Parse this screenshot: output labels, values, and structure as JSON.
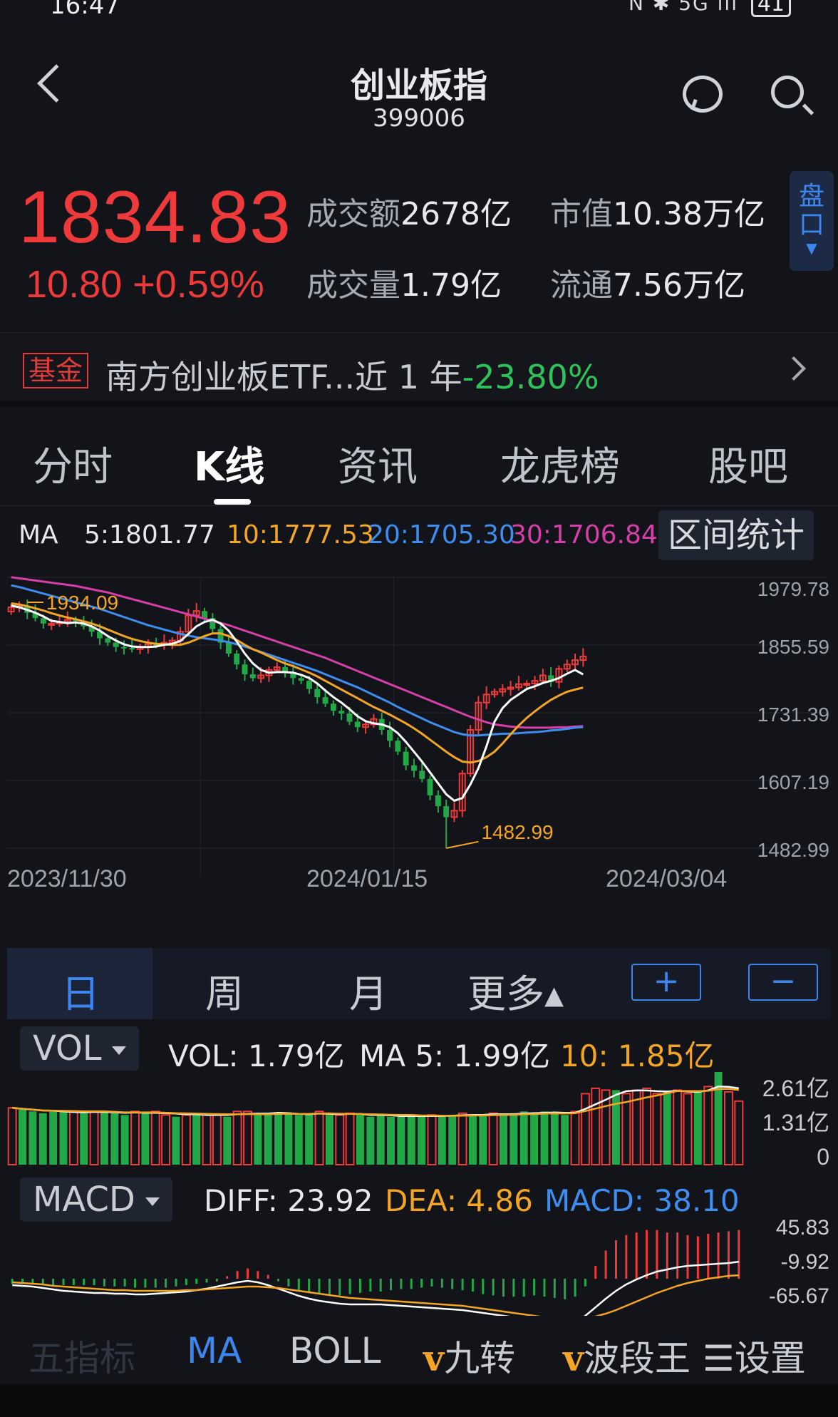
{
  "status_bar": {
    "time": "16:47",
    "battery": "41",
    "signal": "N ✱ 5G ıll"
  },
  "header": {
    "title": "创业板指",
    "code": "399006"
  },
  "quote": {
    "price": "1834.83",
    "change": "10.80 +0.59%",
    "turnover_label": "成交额",
    "turnover_value": "2678亿",
    "market_cap_label": "市值",
    "market_cap_value": "10.38万亿",
    "volume_label": "成交量",
    "volume_value": "1.79亿",
    "float_label": "流通",
    "float_value": "7.56万亿",
    "pankou_label": "盘口",
    "up_color": "#ee3a3a",
    "down_color": "#22a846"
  },
  "fund": {
    "tag": "基金",
    "name": "南方创业板ETF...近 1 年",
    "return": "-23.80%"
  },
  "tabs": [
    {
      "label": "分时"
    },
    {
      "label": "K线",
      "active": true
    },
    {
      "label": "资讯"
    },
    {
      "label": "龙虎榜"
    },
    {
      "label": "股吧"
    }
  ],
  "ma_legend": {
    "label": "MA",
    "ma5": "5:1801.77",
    "ma10": "10:1777.53",
    "ma20": "20:1705.30",
    "ma30": "30:1706.84",
    "range_button": "区间统计",
    "colors": {
      "ma5": "#ffffff",
      "ma10": "#f5a524",
      "ma20": "#3d8ef0",
      "ma30": "#d63fa7"
    }
  },
  "chart_data": {
    "type": "candlestick",
    "y_ticks": [
      "1979.78",
      "1855.59",
      "1731.39",
      "1607.19",
      "1482.99"
    ],
    "ylim": [
      1482.99,
      1979.78
    ],
    "x_ticks": [
      "2023/11/30",
      "2024/01/15",
      "2024/03/04"
    ],
    "annotations": [
      {
        "text": "1934.09"
      },
      {
        "text": "1482.99"
      }
    ],
    "close": [
      1925,
      1927,
      1915,
      1905,
      1895,
      1895,
      1898,
      1902,
      1900,
      1890,
      1880,
      1868,
      1860,
      1852,
      1850,
      1848,
      1852,
      1857,
      1856,
      1860,
      1864,
      1880,
      1910,
      1918,
      1905,
      1885,
      1860,
      1840,
      1820,
      1802,
      1795,
      1800,
      1810,
      1815,
      1805,
      1795,
      1790,
      1775,
      1760,
      1748,
      1735,
      1730,
      1715,
      1705,
      1710,
      1720,
      1700,
      1680,
      1660,
      1635,
      1625,
      1610,
      1580,
      1560,
      1540,
      1552,
      1620,
      1700,
      1750,
      1765,
      1770,
      1775,
      1778,
      1784,
      1785,
      1790,
      1800,
      1788,
      1812,
      1820,
      1828,
      1834.83
    ],
    "ma5": [
      1928,
      1925,
      1920,
      1915,
      1908,
      1900,
      1898,
      1896,
      1897,
      1895,
      1890,
      1882,
      1872,
      1864,
      1857,
      1853,
      1852,
      1852,
      1853,
      1856,
      1858,
      1863,
      1876,
      1890,
      1898,
      1902,
      1895,
      1882,
      1862,
      1840,
      1822,
      1810,
      1805,
      1806,
      1806,
      1805,
      1801,
      1795,
      1785,
      1772,
      1760,
      1750,
      1738,
      1725,
      1716,
      1712,
      1710,
      1705,
      1694,
      1678,
      1660,
      1642,
      1622,
      1602,
      1582,
      1570,
      1575,
      1600,
      1630,
      1670,
      1715,
      1740,
      1755,
      1765,
      1775,
      1780,
      1786,
      1790,
      1795,
      1803,
      1810,
      1801.77
    ],
    "ma10": [
      1932,
      1930,
      1927,
      1923,
      1919,
      1914,
      1910,
      1906,
      1903,
      1899,
      1895,
      1890,
      1884,
      1878,
      1872,
      1867,
      1863,
      1860,
      1858,
      1857,
      1856,
      1856,
      1860,
      1866,
      1872,
      1877,
      1877,
      1872,
      1865,
      1856,
      1848,
      1842,
      1835,
      1828,
      1822,
      1817,
      1811,
      1805,
      1798,
      1790,
      1782,
      1774,
      1766,
      1758,
      1750,
      1742,
      1735,
      1728,
      1720,
      1712,
      1703,
      1693,
      1682,
      1671,
      1660,
      1650,
      1642,
      1640,
      1643,
      1650,
      1660,
      1675,
      1692,
      1708,
      1722,
      1734,
      1745,
      1755,
      1763,
      1770,
      1774,
      1777.53
    ],
    "ma20": [
      1965,
      1962,
      1958,
      1954,
      1950,
      1946,
      1942,
      1938,
      1934,
      1930,
      1926,
      1922,
      1917,
      1912,
      1907,
      1902,
      1897,
      1892,
      1888,
      1884,
      1880,
      1876,
      1873,
      1870,
      1868,
      1866,
      1864,
      1861,
      1857,
      1853,
      1848,
      1843,
      1838,
      1833,
      1828,
      1823,
      1818,
      1813,
      1808,
      1802,
      1796,
      1790,
      1784,
      1778,
      1771,
      1764,
      1757,
      1750,
      1742,
      1735,
      1728,
      1721,
      1714,
      1708,
      1702,
      1696,
      1692,
      1690,
      1690,
      1691,
      1692,
      1693,
      1693,
      1694,
      1695,
      1696,
      1697,
      1699,
      1700,
      1702,
      1704,
      1705.3
    ],
    "ma30": [
      1980,
      1978,
      1976,
      1974,
      1972,
      1970,
      1968,
      1966,
      1964,
      1961,
      1958,
      1955,
      1952,
      1948,
      1944,
      1940,
      1936,
      1932,
      1928,
      1924,
      1920,
      1916,
      1912,
      1908,
      1904,
      1900,
      1896,
      1892,
      1887,
      1882,
      1877,
      1872,
      1867,
      1862,
      1857,
      1852,
      1847,
      1842,
      1837,
      1832,
      1826,
      1820,
      1814,
      1808,
      1802,
      1796,
      1790,
      1784,
      1778,
      1772,
      1766,
      1760,
      1754,
      1748,
      1742,
      1736,
      1730,
      1724,
      1719,
      1714,
      1710,
      1708,
      1706,
      1705,
      1704,
      1704,
      1704,
      1704,
      1705,
      1705,
      1706,
      1706.84
    ]
  },
  "periods": {
    "day": "日",
    "week": "周",
    "month": "月",
    "more": "更多▴",
    "plus": "+",
    "minus": "−"
  },
  "volume": {
    "button": "VOL",
    "vol": "VOL: 1.79亿",
    "ma5": "MA 5: 1.99亿",
    "ma10": "10: 1.85亿",
    "y_ticks": [
      "2.61亿",
      "1.31亿",
      "0"
    ],
    "ylim": [
      0,
      2.61
    ],
    "values": [
      1.6,
      1.55,
      1.5,
      1.45,
      1.5,
      1.5,
      1.48,
      1.45,
      1.5,
      1.5,
      1.45,
      1.4,
      1.5,
      1.45,
      1.5,
      1.4,
      1.35,
      1.4,
      1.45,
      1.4,
      1.4,
      1.35,
      1.5,
      1.5,
      1.45,
      1.4,
      1.45,
      1.45,
      1.4,
      1.4,
      1.5,
      1.4,
      1.4,
      1.45,
      1.4,
      1.35,
      1.4,
      1.35,
      1.35,
      1.4,
      1.35,
      1.4,
      1.35,
      1.4,
      1.45,
      1.4,
      1.4,
      1.45,
      1.4,
      1.45,
      1.5,
      1.45,
      1.5,
      1.45,
      1.4,
      1.5,
      2.0,
      2.15,
      2.1,
      2.1,
      2.0,
      2.1,
      2.15,
      2.0,
      2.05,
      2.1,
      2.0,
      2.1,
      2.2,
      2.61,
      2.05,
      1.79
    ],
    "up": [
      1,
      0,
      0,
      0,
      0,
      0,
      1,
      0,
      1,
      0,
      0,
      0,
      1,
      0,
      1,
      1,
      0,
      1,
      0,
      1,
      1,
      0,
      1,
      1,
      0,
      0,
      0,
      0,
      0,
      0,
      1,
      0,
      1,
      1,
      0,
      0,
      0,
      0,
      0,
      0,
      0,
      1,
      0,
      0,
      1,
      0,
      0,
      1,
      0,
      0,
      0,
      0,
      0,
      0,
      0,
      1,
      1,
      1,
      1,
      0,
      1,
      1,
      1,
      1,
      0,
      1,
      1,
      0,
      1,
      0,
      1,
      1
    ]
  },
  "macd": {
    "button": "MACD",
    "diff": "DIFF: 23.92",
    "dea": "DEA: 4.86",
    "macd": "MACD: 38.10",
    "y_ticks": [
      "45.83",
      "-9.92",
      "-65.67"
    ],
    "ylim": [
      -65.67,
      45.83
    ],
    "hist": [
      -4,
      -4,
      -4,
      -4,
      -5,
      -5,
      -5,
      -5,
      -5,
      -6,
      -6,
      -6,
      -7,
      -7,
      -7,
      -7,
      -6,
      -5,
      -4,
      -3,
      -2,
      2,
      6,
      8,
      6,
      3,
      -2,
      -6,
      -9,
      -11,
      -12,
      -13,
      -13,
      -12,
      -11,
      -10,
      -10,
      -9,
      -8,
      -8,
      -7,
      -6,
      -7,
      -8,
      -9,
      -10,
      -12,
      -13,
      -14,
      -14,
      -14,
      -13,
      -14,
      -15,
      -16,
      -14,
      -6,
      10,
      22,
      30,
      34,
      36,
      38,
      38,
      36,
      36,
      34,
      33,
      35,
      36,
      37,
      38
    ],
    "diff_line": [
      -9,
      -10,
      -11,
      -13,
      -15,
      -17,
      -18,
      -19,
      -20,
      -20,
      -21,
      -21,
      -22,
      -22,
      -21,
      -20,
      -19,
      -18,
      -16,
      -14,
      -11,
      -8,
      -5,
      -3,
      -5,
      -9,
      -14,
      -19,
      -24,
      -28,
      -31,
      -33,
      -35,
      -36,
      -36,
      -36,
      -36,
      -37,
      -38,
      -39,
      -40,
      -41,
      -42,
      -43,
      -44,
      -46,
      -48,
      -50,
      -52,
      -54,
      -56,
      -57,
      -59,
      -60,
      -61,
      -60,
      -52,
      -40,
      -28,
      -17,
      -8,
      -1,
      5,
      10,
      13,
      16,
      18,
      19,
      20,
      21,
      22,
      23.92
    ],
    "dea_line": [
      -5,
      -6,
      -7,
      -8,
      -10,
      -11,
      -12,
      -13,
      -14,
      -15,
      -16,
      -16,
      -17,
      -17,
      -17,
      -17,
      -17,
      -16,
      -16,
      -15,
      -14,
      -13,
      -12,
      -11,
      -11,
      -12,
      -13,
      -15,
      -17,
      -19,
      -21,
      -23,
      -25,
      -27,
      -28,
      -29,
      -30,
      -31,
      -32,
      -33,
      -34,
      -35,
      -36,
      -37,
      -38,
      -40,
      -42,
      -44,
      -46,
      -48,
      -50,
      -52,
      -54,
      -55,
      -56,
      -57,
      -56,
      -53,
      -49,
      -44,
      -38,
      -32,
      -26,
      -20,
      -15,
      -10,
      -6,
      -3,
      0,
      2,
      4,
      4.86
    ]
  },
  "bottom_bar": {
    "item0": "五指标",
    "ma": "MA",
    "boll": "BOLL",
    "jiuzhuan": "九转",
    "boduan": "波段王",
    "settings": "设置",
    "v_color": "#f5a524"
  }
}
